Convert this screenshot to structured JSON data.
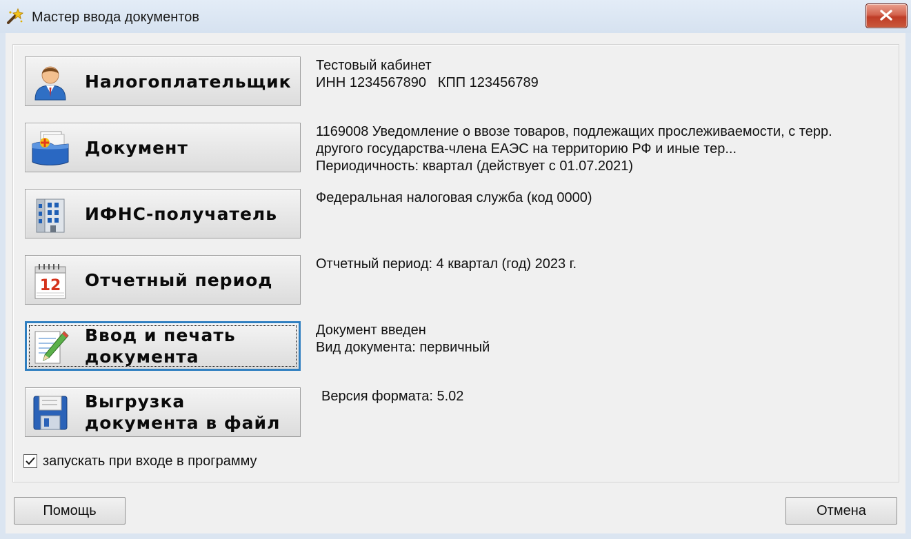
{
  "window": {
    "title": "Мастер ввода документов",
    "icon": "wizard-wand-icon",
    "close_icon": "close-icon"
  },
  "steps": [
    {
      "label": "Налогоплательщик",
      "icon": "taxpayer-person-icon",
      "info": [
        "Тестовый кабинет",
        "ИНН 1234567890   КПП 123456789"
      ]
    },
    {
      "label": "Документ",
      "icon": "document-folder-icon",
      "info": [
        "1169008 Уведомление о ввозе товаров, подлежащих прослеживаемости, с терр.",
        "другого государства-члена ЕАЭС на территорию РФ и иные тер...",
        "Периодичность: квартал (действует с 01.07.2021)"
      ]
    },
    {
      "label": "ИФНС-получатель",
      "icon": "office-building-icon",
      "info": [
        "Федеральная налоговая служба (код 0000)"
      ]
    },
    {
      "label": "Отчетный период",
      "icon": "calendar-icon",
      "calendar_number": "12",
      "info": [
        "Отчетный период: 4 квартал (год) 2023 г."
      ]
    },
    {
      "label_lines": [
        "Ввод и печать",
        "документа"
      ],
      "icon": "edit-pencil-icon",
      "focused": true,
      "info": [
        "Документ введен",
        "Вид документа: первичный"
      ]
    },
    {
      "label_lines": [
        "Выгрузка",
        "документа в файл"
      ],
      "icon": "floppy-disk-icon",
      "info": [
        "Версия формата: 5.02"
      ]
    }
  ],
  "autostart": {
    "label": "запускать при входе в программу",
    "checked": true
  },
  "buttons": {
    "help": "Помощь",
    "cancel": "Отмена"
  },
  "colors": {
    "focus_border": "#2f7fc0",
    "close_button": "#c94a34",
    "titlebar": "#dbe5f1"
  }
}
